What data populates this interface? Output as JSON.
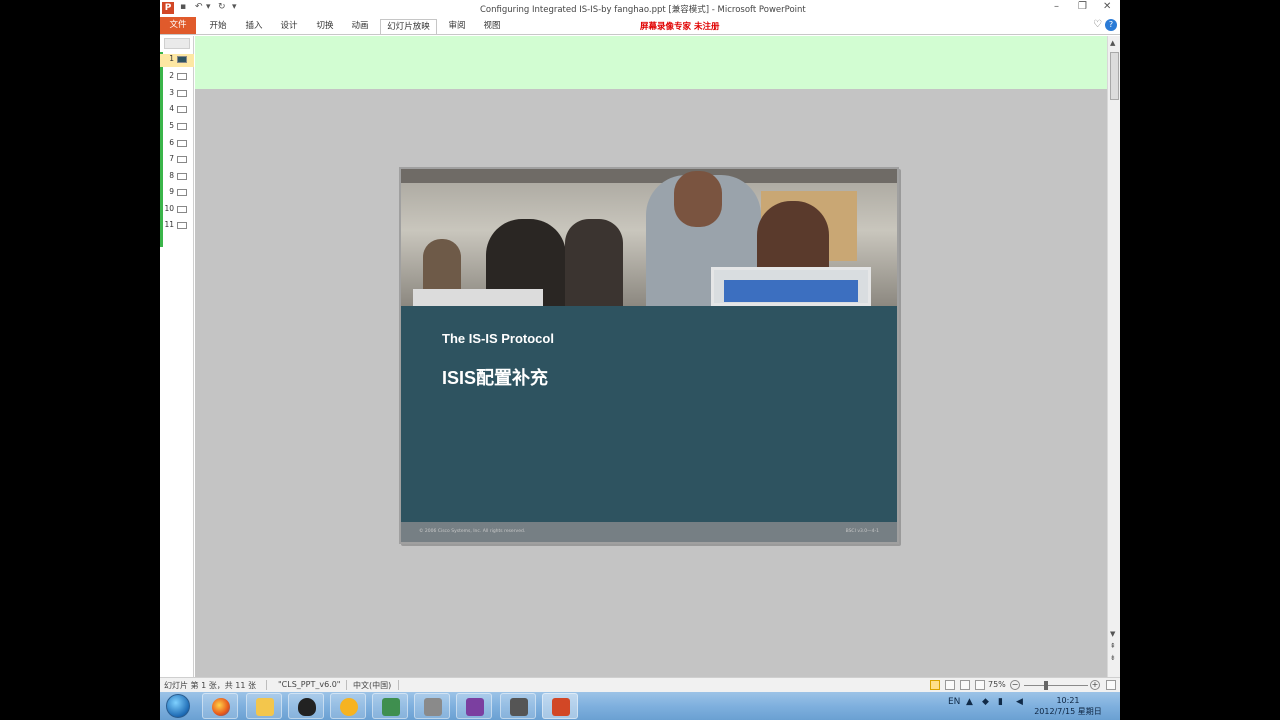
{
  "window": {
    "title": "Configuring  Integrated IS-IS-by fanghao.ppt [兼容模式] - Microsoft PowerPoint",
    "app_icon_letter": "P"
  },
  "ribbon": {
    "tabs": [
      {
        "label": "文件"
      },
      {
        "label": "开始"
      },
      {
        "label": "插入"
      },
      {
        "label": "设计"
      },
      {
        "label": "切换"
      },
      {
        "label": "动画"
      },
      {
        "label": "幻灯片放映"
      },
      {
        "label": "审阅"
      },
      {
        "label": "视图"
      }
    ],
    "active_tab": "幻灯片放映",
    "watermark": "屏幕录像专家  未注册",
    "help_icon": "?"
  },
  "thumbnails": {
    "selected": 1,
    "slides": [
      "1",
      "2",
      "3",
      "4",
      "5",
      "6",
      "7",
      "8",
      "9",
      "10",
      "11"
    ]
  },
  "slide": {
    "subtitle": "The IS-IS Protocol",
    "title": "ISIS配置补充",
    "footer_left": "© 2006 Cisco Systems, Inc.  All rights reserved.",
    "footer_right": "BSCI v3.0—4-1",
    "colors": {
      "body": "#2e5360",
      "footer": "#767f84"
    }
  },
  "status": {
    "slide_info": "幻灯片 第 1 张，共 11 张",
    "theme": "\"CLS_PPT_v6.0\"",
    "language": "中文(中国)",
    "zoom": "75%"
  },
  "taskbar": {
    "ime": "EN",
    "clock_time": "10:21",
    "clock_date": "2012/7/15 星期日"
  }
}
